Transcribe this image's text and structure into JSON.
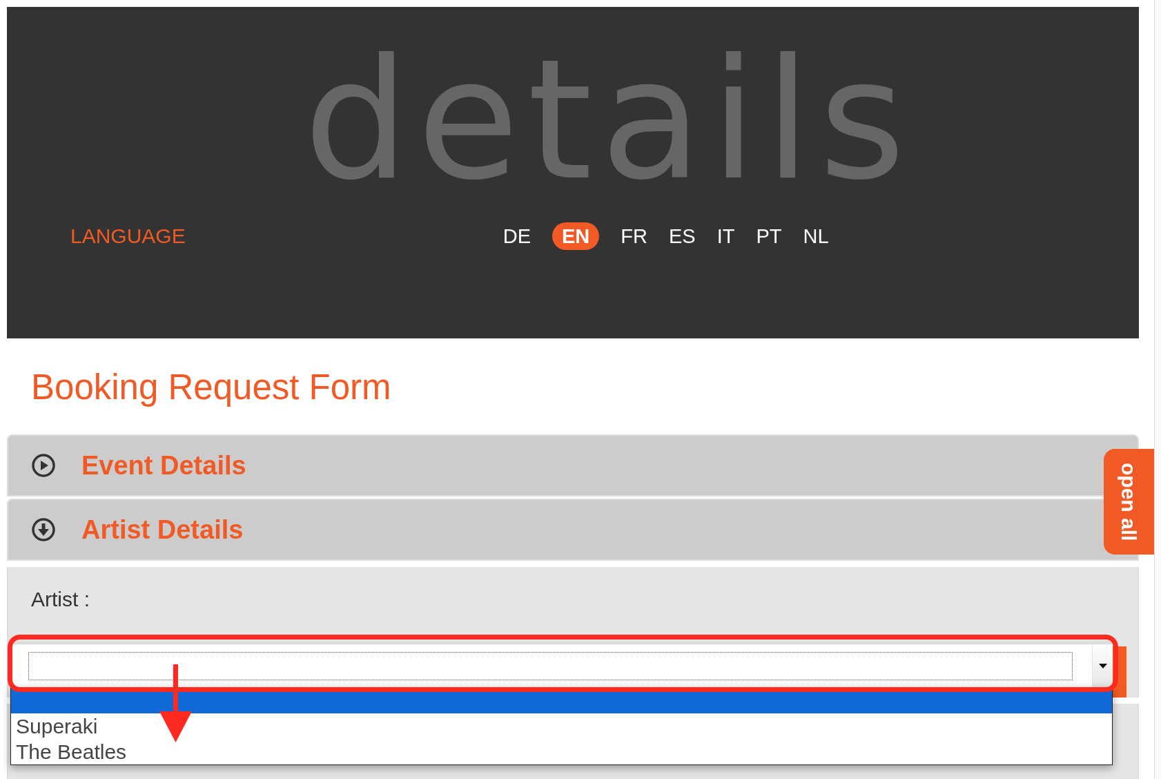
{
  "header": {
    "logo": "details",
    "language_label": "LANGUAGE",
    "languages": [
      {
        "label": "DE",
        "selected": false
      },
      {
        "label": "EN",
        "selected": true
      },
      {
        "label": "FR",
        "selected": false
      },
      {
        "label": "ES",
        "selected": false
      },
      {
        "label": "IT",
        "selected": false
      },
      {
        "label": "PT",
        "selected": false
      },
      {
        "label": "NL",
        "selected": false
      }
    ]
  },
  "page_title": "Booking Request Form",
  "open_all_button": {
    "label": "open all"
  },
  "sections": [
    {
      "title": "Event Details",
      "expanded": false
    },
    {
      "title": "Artist Details",
      "expanded": true,
      "fields": [
        {
          "kind": "select",
          "label": "Artist :",
          "open": true,
          "options": [
            {
              "selected": true
            },
            {
              "label": "Superaki",
              "selected": false
            },
            {
              "label": "The Beatles",
              "selected": false
            }
          ]
        }
      ]
    }
  ]
}
